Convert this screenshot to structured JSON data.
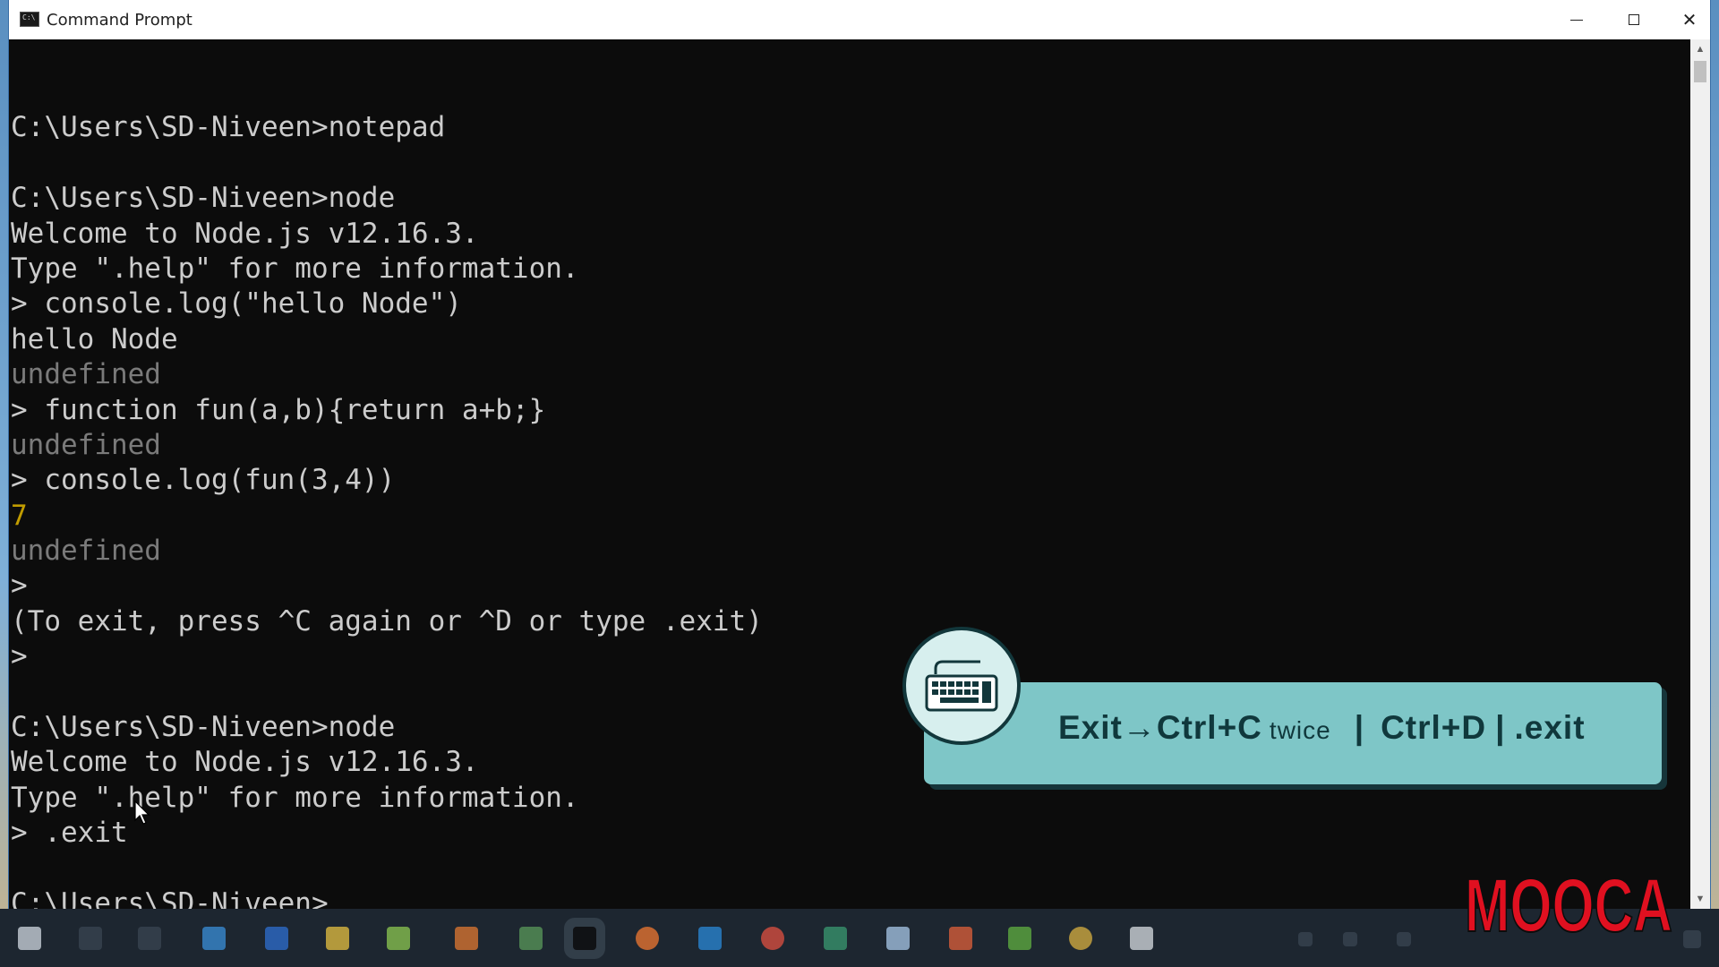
{
  "window": {
    "title": "Command Prompt",
    "controls": {
      "minimize": "—",
      "maximize": "□",
      "close": "✕"
    }
  },
  "console": {
    "lines": [
      {
        "text": "",
        "style": "normal"
      },
      {
        "text": "C:\\Users\\SD-Niveen>notepad",
        "style": "normal"
      },
      {
        "text": "",
        "style": "normal"
      },
      {
        "text": "C:\\Users\\SD-Niveen>node",
        "style": "normal"
      },
      {
        "text": "Welcome to Node.js v12.16.3.",
        "style": "normal"
      },
      {
        "text": "Type \".help\" for more information.",
        "style": "normal"
      },
      {
        "text": "> console.log(\"hello Node\")",
        "style": "normal"
      },
      {
        "text": "hello Node",
        "style": "normal"
      },
      {
        "text": "undefined",
        "style": "grey"
      },
      {
        "text": "> function fun(a,b){return a+b;}",
        "style": "normal"
      },
      {
        "text": "undefined",
        "style": "grey"
      },
      {
        "text": "> console.log(fun(3,4))",
        "style": "normal"
      },
      {
        "text": "7",
        "style": "yellow"
      },
      {
        "text": "undefined",
        "style": "grey"
      },
      {
        "text": ">",
        "style": "normal"
      },
      {
        "text": "(To exit, press ^C again or ^D or type .exit)",
        "style": "normal"
      },
      {
        "text": ">",
        "style": "normal"
      },
      {
        "text": "",
        "style": "normal"
      },
      {
        "text": "C:\\Users\\SD-Niveen>node",
        "style": "normal"
      },
      {
        "text": "Welcome to Node.js v12.16.3.",
        "style": "normal"
      },
      {
        "text": "Type \".help\" for more information.",
        "style": "normal"
      },
      {
        "text": "> .exit",
        "style": "normal"
      },
      {
        "text": "",
        "style": "normal"
      },
      {
        "text": "C:\\Users\\SD-Niveen>",
        "style": "normal",
        "cursor": true
      }
    ]
  },
  "hint": {
    "exit": "Exit",
    "arrow": "→",
    "ctrl_c": "Ctrl+C",
    "twice": "twice",
    "sep1": "|",
    "ctrl_d": "Ctrl+D",
    "sep2": "|",
    "dot_exit": ".exit",
    "icon": "keyboard-icon"
  },
  "logo": {
    "text": "MOOCA",
    "color": "#e01020"
  },
  "colors": {
    "console_bg": "#0c0c0c",
    "console_fg": "#cccccc",
    "undefined_grey": "#7a7a7a",
    "number_yellow": "#c19c00",
    "hint_bg": "#7ec6c7"
  }
}
